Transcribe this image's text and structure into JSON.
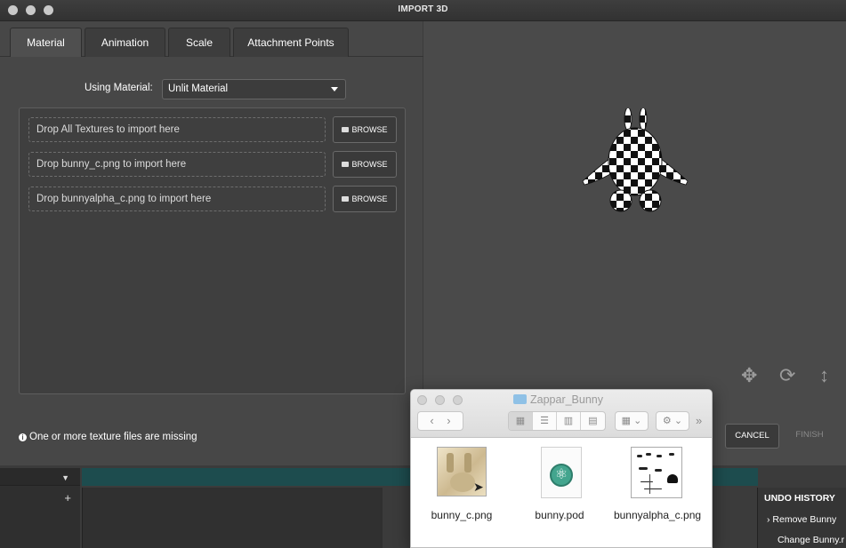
{
  "window": {
    "title": "IMPORT 3D"
  },
  "tabs": [
    {
      "label": "Material",
      "active": true
    },
    {
      "label": "Animation",
      "active": false
    },
    {
      "label": "Scale",
      "active": false
    },
    {
      "label": "Attachment Points",
      "active": false
    }
  ],
  "material": {
    "label": "Using Material:",
    "value": "Unlit Material"
  },
  "drop_rows": [
    {
      "text": "Drop All Textures to import here",
      "button": "BROWSE"
    },
    {
      "text": "Drop bunny_c.png to import here",
      "button": "BROWSE"
    },
    {
      "text": "Drop bunnyalpha_c.png to import here",
      "button": "BROWSE"
    }
  ],
  "status": {
    "icon": "info-icon",
    "message": "One or more texture files are missing"
  },
  "viewport_controls": [
    "move-icon",
    "rotate-icon",
    "scale-icon"
  ],
  "buttons": {
    "cancel": "CANCEL",
    "finish": "FINISH"
  },
  "finder": {
    "title": "Zappar_Bunny",
    "files": [
      {
        "name": "bunny_c.png",
        "icon": "texture-thumbnail"
      },
      {
        "name": "bunny.pod",
        "icon": "atom-document-icon"
      },
      {
        "name": "bunnyalpha_c.png",
        "icon": "alpha-texture-thumbnail"
      }
    ]
  },
  "undo_history": {
    "title": "UNDO HISTORY",
    "items": [
      "Remove Bunny",
      "Change Bunny.r"
    ]
  },
  "colors": {
    "accent_teal": "#1d4c4e",
    "dialog_bg": "#4a4a4a"
  }
}
